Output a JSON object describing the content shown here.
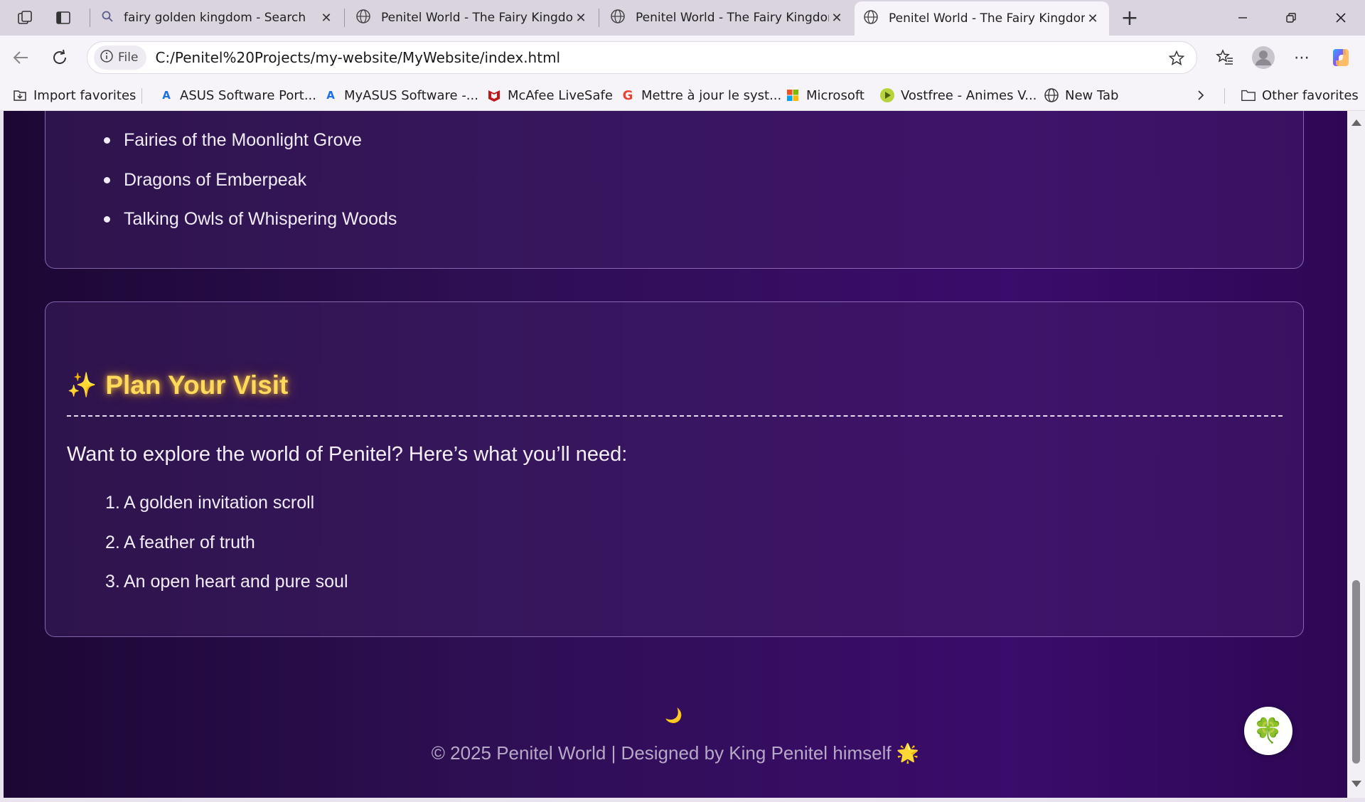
{
  "browser": {
    "tabs": [
      {
        "title": "fairy golden kingdom - Search",
        "icon": "search-icon"
      },
      {
        "title": "Penitel World - The Fairy Kingdom",
        "icon": "globe-icon"
      },
      {
        "title": "Penitel World - The Fairy Kingdom",
        "icon": "globe-icon"
      },
      {
        "title": "Penitel World - The Fairy Kingdom",
        "icon": "globe-icon",
        "active": true
      }
    ],
    "address": {
      "scheme_label": "File",
      "url": "C:/Penitel%20Projects/my-website/MyWebsite/index.html"
    },
    "favorites": [
      {
        "label": "Import favorites",
        "icon": "import-icon"
      },
      {
        "label": "ASUS Software Port...",
        "icon": "asus-icon"
      },
      {
        "label": "MyASUS Software -...",
        "icon": "asus-icon"
      },
      {
        "label": "McAfee LiveSafe",
        "icon": "mcafee-icon"
      },
      {
        "label": "Mettre à jour le syst...",
        "icon": "google-icon"
      },
      {
        "label": "Microsoft",
        "icon": "microsoft-icon"
      },
      {
        "label": "Vostfree - Animes V...",
        "icon": "vostfree-icon"
      },
      {
        "label": "New Tab",
        "icon": "globe-icon"
      }
    ],
    "other_favorites": "Other favorites"
  },
  "page": {
    "creatures": [
      "Fairies of the Moonlight Grove",
      "Dragons of Emberpeak",
      "Talking Owls of Whispering Woods"
    ],
    "plan": {
      "sparkle": "✨",
      "title": "Plan Your Visit",
      "intro": "Want to explore the world of Penitel? Here’s what you’ll need:",
      "items": [
        {
          "num": "1.",
          "text": "A golden invitation scroll"
        },
        {
          "num": "2.",
          "text": "A feather of truth"
        },
        {
          "num": "3.",
          "text": "An open heart and pure soul"
        }
      ]
    },
    "footer": {
      "moon": "🌙",
      "text": "© 2025 Penitel World | Designed by King Penitel himself 🌟"
    },
    "floating_button": {
      "icon": "🍀"
    }
  },
  "colors": {
    "heading_gold": "#ffd95a",
    "page_bg_dark": "#1c0734",
    "page_bg_light": "#3a0c6b"
  }
}
